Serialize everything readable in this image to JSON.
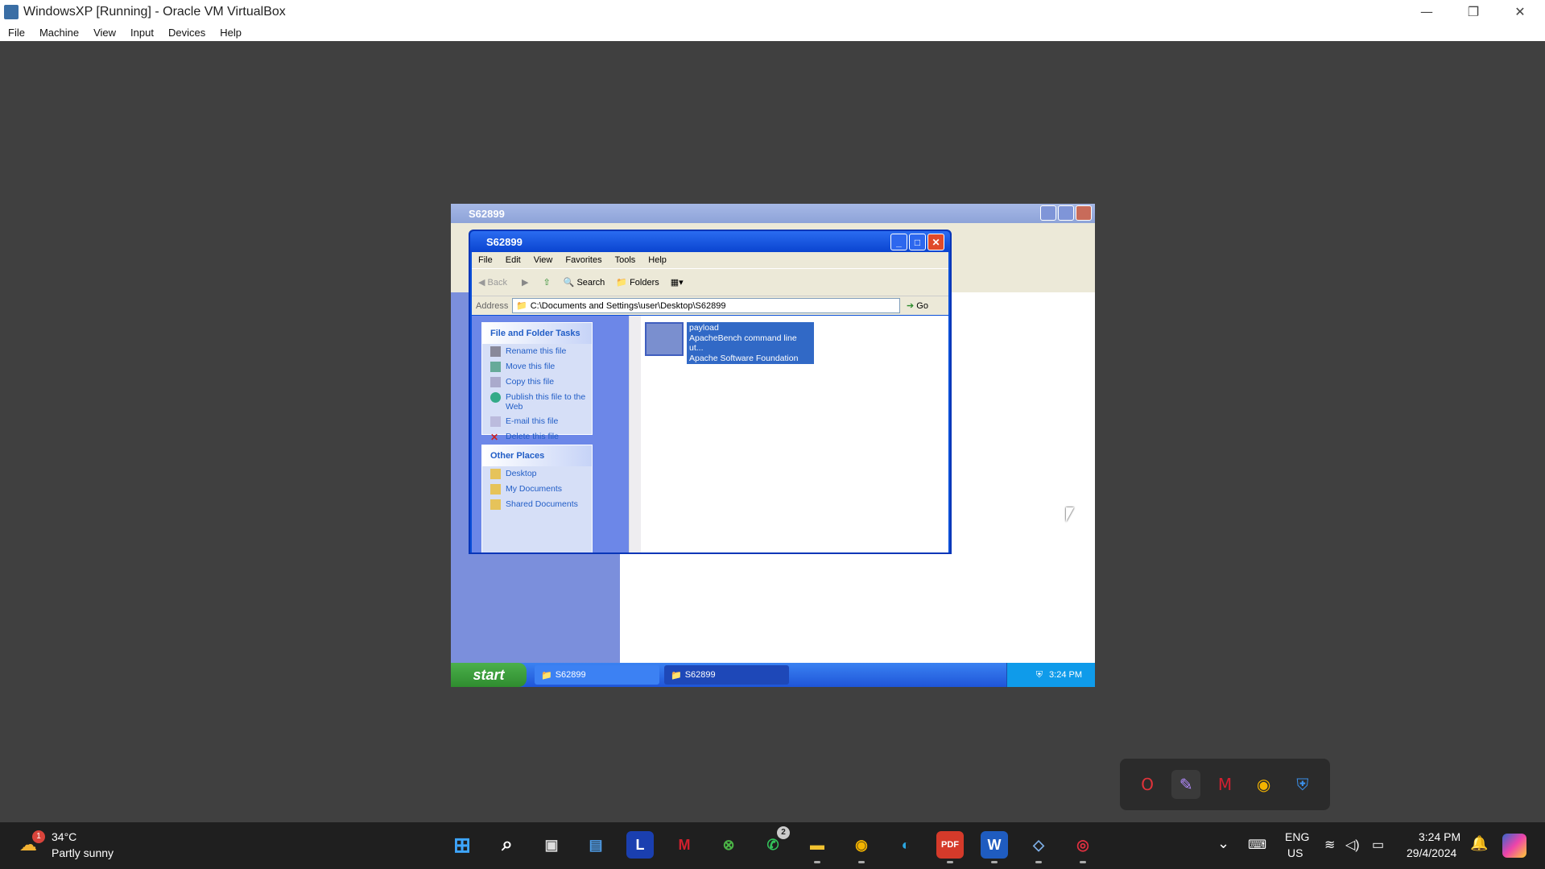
{
  "host": {
    "title": "WindowsXP [Running] - Oracle VM VirtualBox",
    "menu": [
      "File",
      "Machine",
      "View",
      "Input",
      "Devices",
      "Help"
    ]
  },
  "xp": {
    "back_window_title": "S62899",
    "front_window": {
      "title": "S62899",
      "menu": [
        "File",
        "Edit",
        "View",
        "Favorites",
        "Tools",
        "Help"
      ],
      "toolbar": {
        "back": "Back",
        "search": "Search",
        "folders": "Folders"
      },
      "address_label": "Address",
      "address_value": "C:\\Documents and Settings\\user\\Desktop\\S62899",
      "go_label": "Go",
      "tasks_panel": {
        "title": "File and Folder Tasks",
        "items": [
          "Rename this file",
          "Move this file",
          "Copy this file",
          "Publish this file to the Web",
          "E-mail this file",
          "Delete this file"
        ]
      },
      "places_panel": {
        "title": "Other Places",
        "items": [
          "Desktop",
          "My Documents",
          "Shared Documents"
        ]
      },
      "file": {
        "name": "payload",
        "description": "ApacheBench command line ut...",
        "company": "Apache Software Foundation"
      }
    },
    "taskbar": {
      "start": "start",
      "tasks": [
        "S62899",
        "S62899"
      ],
      "clock": "3:24 PM"
    }
  },
  "win": {
    "weather": {
      "temp": "34°C",
      "condition": "Partly sunny",
      "badge": "1"
    },
    "whatsapp_badge": "2",
    "lang": {
      "line1": "ENG",
      "line2": "US"
    },
    "clock": {
      "time": "3:24 PM",
      "date": "29/4/2024"
    }
  },
  "colors": {
    "xp_blue": "#0a4fd8",
    "selection": "#3169c6",
    "taskbar": "#1f1f1f"
  }
}
